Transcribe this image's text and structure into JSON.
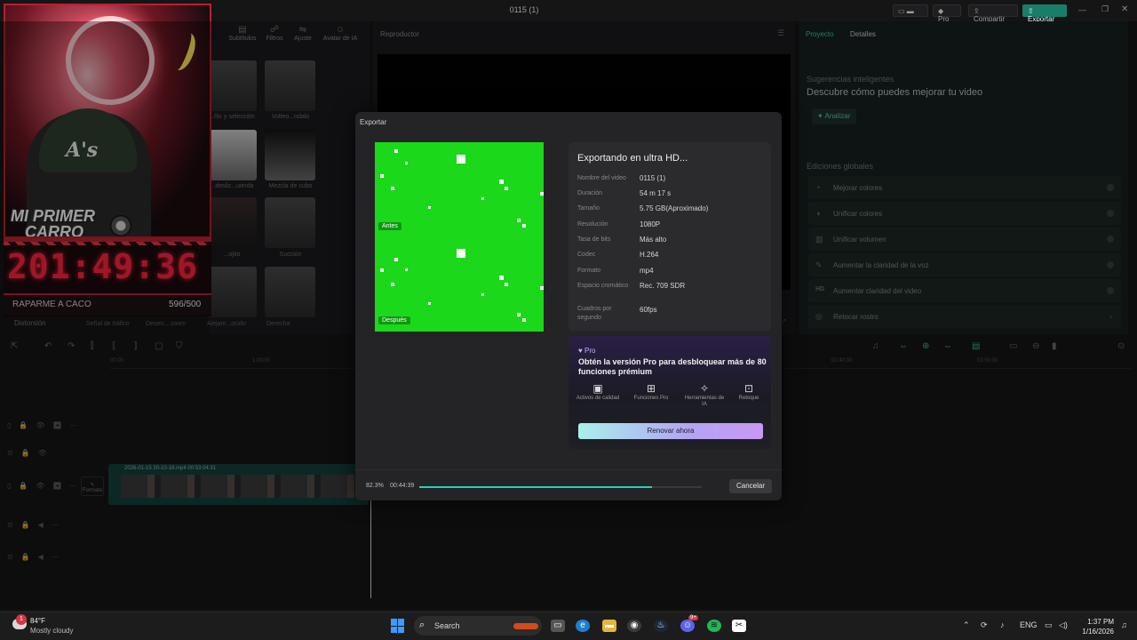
{
  "window": {
    "title": "0115 (1)",
    "pro_label": "Pro",
    "share_label": "Compartir",
    "export_label": "Exportar"
  },
  "media": {
    "tabs": [
      "Subtítulos",
      "Filtros",
      "Ajuste",
      "Avatar de IA"
    ],
    "tab_icons": [
      "subtitle-icon",
      "filter-icon",
      "adjust-icon",
      "avatar-icon"
    ],
    "thumb_labels": [
      "...ñic y selección",
      "Volteo...ndalo",
      "...desliz...uierda",
      "Mezcla de cubo",
      "...ojito",
      "Succión",
      "",
      ""
    ],
    "bottom_labels": [
      "Distorsión",
      "Señal de tráfico",
      "Desen... zoom",
      "Alejam...ocido",
      "Derecha"
    ]
  },
  "player": {
    "title": "Reproductor"
  },
  "props": {
    "tabs": [
      "Proyecto",
      "Detalles"
    ],
    "suggestions_title": "Sugerencias inteligentes",
    "suggestions_head": "Descubre cómo puedes mejorar tu video",
    "analyze_label": "Analizar",
    "global_title": "Ediciones globales",
    "options": [
      {
        "icon": "color-icon",
        "label": "Mejorar colores"
      },
      {
        "icon": "palette-icon",
        "label": "Unificar colores"
      },
      {
        "icon": "volume-icon",
        "label": "Unificar volumen"
      },
      {
        "icon": "voice-icon",
        "label": "Aumentar la claridad de la voz"
      },
      {
        "icon": "hd-icon",
        "label": "Aumentar claridad del video"
      },
      {
        "icon": "retouch-icon",
        "label": "Retocar rostro"
      }
    ]
  },
  "timeline": {
    "ruler_marks": [
      "00:00",
      "1:00:00",
      "02:40:00",
      "03:00:00"
    ],
    "clip_label": "2026-01-15 20-10-18.mp4   00:53:04:31",
    "format_label": "Formato"
  },
  "stream": {
    "cap_logo": "A's",
    "brand_line1": "MI PRIMER",
    "brand_line2": "CARRO",
    "timer": "201:49:36",
    "goal_label": "RAPARME A CACO",
    "goal_count": "596/500"
  },
  "export": {
    "title": "Exportar",
    "before_label": "Antes",
    "after_label": "Después",
    "heading": "Exportando en ultra HD...",
    "rows": [
      {
        "key": "Nombre del video",
        "value": "0115 (1)"
      },
      {
        "key": "Duración",
        "value": "54 m 17 s"
      },
      {
        "key": "Tamaño",
        "value": "5.75 GB(Aproximado)"
      },
      {
        "key": "Resolución",
        "value": "1080P"
      },
      {
        "key": "Tasa de bits",
        "value": "Más alto"
      },
      {
        "key": "Codec",
        "value": "H.264"
      },
      {
        "key": "Formato",
        "value": "mp4"
      },
      {
        "key": "Espacio cromático",
        "value": "Rec. 709 SDR"
      },
      {
        "key": "Cuadros por segundo",
        "value": "60fps"
      }
    ],
    "pro_badge": "Pro",
    "pro_heading": "Obtén la versión Pro para desbloquear más de 80 funciones prémium",
    "features": [
      {
        "icon": "image-quality-icon",
        "label": "Activos de calidad"
      },
      {
        "icon": "grid-icon",
        "label": "Funciones Pro"
      },
      {
        "icon": "magic-wand-icon",
        "label": "Herramientas de IA"
      },
      {
        "icon": "retouch-icon",
        "label": "Retoque"
      }
    ],
    "renew_label": "Renovar ahora",
    "progress_pct_label": "82.3%",
    "progress_fraction": 0.823,
    "elapsed": "00:44:39",
    "cancel_label": "Cancelar"
  },
  "taskbar": {
    "weather_badge": "1",
    "temperature": "84°F",
    "condition": "Mostly cloudy",
    "search_placeholder": "Search",
    "language": "ENG",
    "time": "1:37 PM",
    "date": "1/16/2026",
    "notification_count": "9+"
  }
}
